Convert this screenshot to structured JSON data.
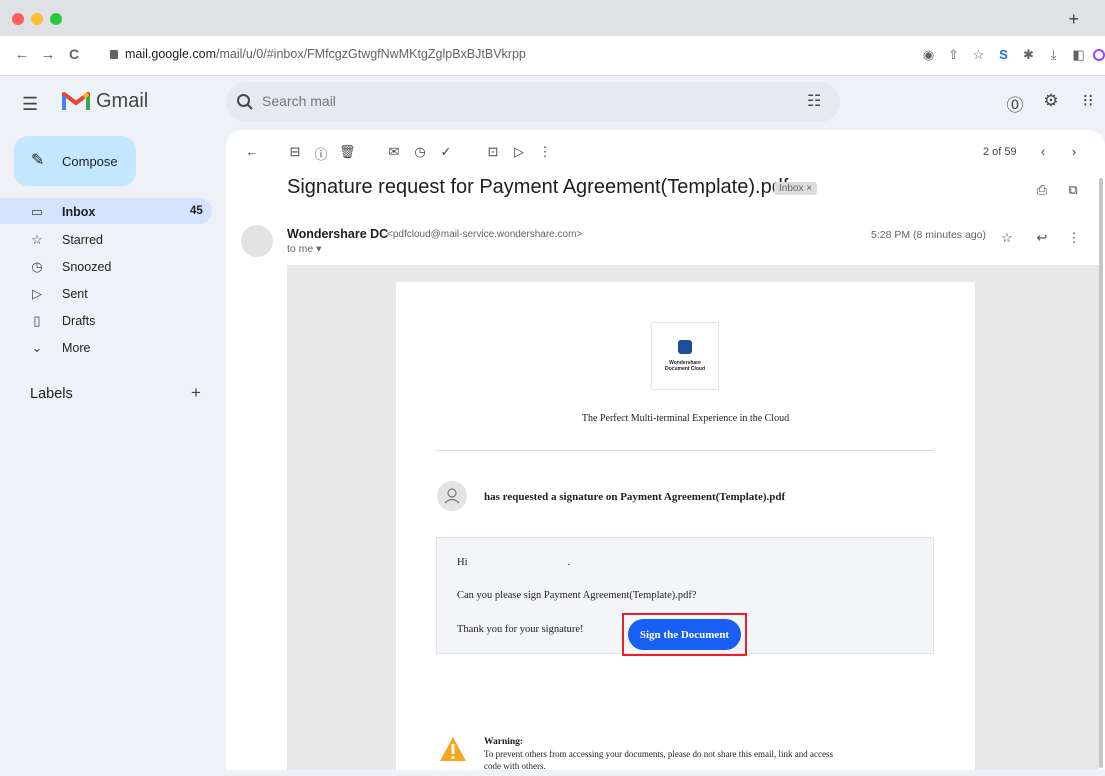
{
  "browser": {
    "new_tab_label": "+",
    "back": "←",
    "forward": "→",
    "reload": "C",
    "url_host": "mail.google.com",
    "url_path": "/mail/u/0/#inbox/FMfcgzGtwgfNwMKtgZglpBxBJtBVkrpp"
  },
  "app": {
    "name": "Gmail",
    "search_placeholder": "Search mail"
  },
  "sidebar": {
    "compose_label": "Compose",
    "items": [
      {
        "label": "Inbox",
        "count": "45",
        "icon": "inbox-icon",
        "active": true
      },
      {
        "label": "Starred",
        "count": "",
        "icon": "star-icon"
      },
      {
        "label": "Snoozed",
        "count": "",
        "icon": "clock-icon"
      },
      {
        "label": "Sent",
        "count": "",
        "icon": "send-icon"
      },
      {
        "label": "Drafts",
        "count": "",
        "icon": "draft-icon"
      },
      {
        "label": "More",
        "count": "",
        "icon": "chevron-down-icon"
      }
    ],
    "labels_title": "Labels",
    "labels_add": "+"
  },
  "toolbar": {
    "pager": "2 of 59"
  },
  "email": {
    "subject": "Signature request for Payment Agreement(Template).pdf",
    "label_chip": "Inbox ×",
    "sender_name": "Wondershare DC",
    "sender_email": "<pdfcloud@mail-service.wondershare.com>",
    "to": "to me ▾",
    "time": "5:28 PM (8 minutes ago)"
  },
  "body": {
    "logo_line1": "Wondershare",
    "logo_line2": "Document Cloud",
    "tagline": "The Perfect Multi-terminal Experience in the Cloud",
    "request_text": "has requested a signature on Payment Agreement(Template).pdf",
    "greeting": "Hi",
    "greeting_end": ".",
    "message": "Can you please sign Payment Agreement(Template).pdf?",
    "thanks": "Thank you for your signature!",
    "button_label": "Sign the Document",
    "warning_title": "Warning:",
    "warning_text": "To prevent others from accessing your documents, please do not share this email, link and access",
    "warning_cont": "code with others."
  },
  "colors": {
    "accent_compose": "#c2e7ff",
    "active_nav": "#d3e3fd",
    "sign_button": "#1a5ff5",
    "highlight_box": "#e8202a"
  }
}
